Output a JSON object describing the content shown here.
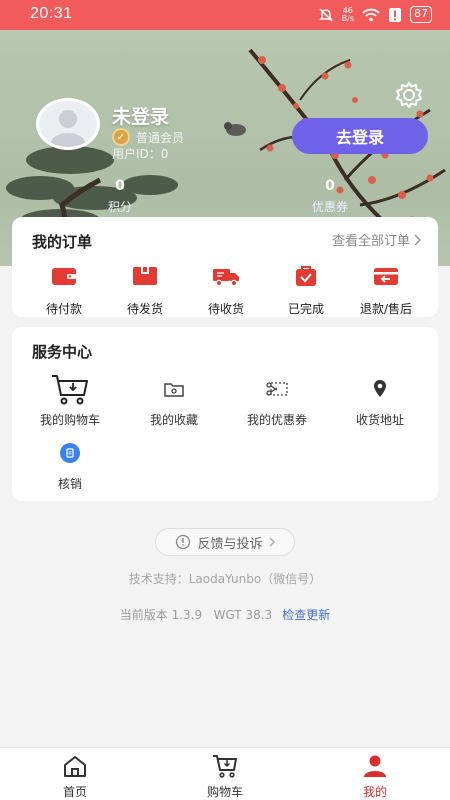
{
  "status_bar": {
    "time": "20:31",
    "network_speed_top": "46",
    "network_speed_bottom": "B/s",
    "battery": "87"
  },
  "profile": {
    "name": "未登录",
    "member_level": "普通会员",
    "user_id": "用户ID：0",
    "login_button": "去登录",
    "points_value": "0",
    "points_label": "积分",
    "coupons_value": "0",
    "coupons_label": "优惠券"
  },
  "orders": {
    "title": "我的订单",
    "view_all": "查看全部订单",
    "items": [
      {
        "label": "待付款",
        "icon": "wallet-icon"
      },
      {
        "label": "待发货",
        "icon": "package-icon"
      },
      {
        "label": "待收货",
        "icon": "truck-icon"
      },
      {
        "label": "已完成",
        "icon": "check-bag-icon"
      },
      {
        "label": "退款/售后",
        "icon": "refund-icon"
      }
    ]
  },
  "services": {
    "title": "服务中心",
    "items": [
      {
        "label": "我的购物车",
        "icon": "cart-icon"
      },
      {
        "label": "我的收藏",
        "icon": "folder-icon"
      },
      {
        "label": "我的优惠券",
        "icon": "scissors-coupon-icon"
      },
      {
        "label": "收货地址",
        "icon": "location-pin-icon"
      },
      {
        "label": "核销",
        "icon": "verify-icon"
      }
    ]
  },
  "footer": {
    "feedback": "反馈与投诉",
    "support": "技术支持：LaodaYunbo（微信号）",
    "version": "当前版本 1.3.9   WGT 38.3",
    "check_update": "检查更新"
  },
  "tabbar": {
    "items": [
      {
        "label": "首页",
        "icon": "home-icon"
      },
      {
        "label": "购物车",
        "icon": "cart-icon"
      },
      {
        "label": "我的",
        "icon": "user-icon"
      }
    ],
    "active_index": 2
  },
  "colors": {
    "status_bar": "#f25b5b",
    "accent_red": "#d9302f",
    "login_button": "#7062e8",
    "link_blue": "#4a6cc8"
  }
}
